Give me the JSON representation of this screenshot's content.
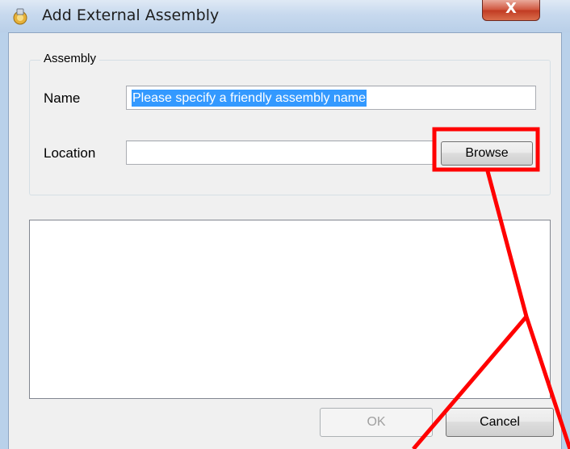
{
  "window": {
    "title": "Add External Assembly",
    "close_glyph": "X"
  },
  "assembly_group": {
    "legend": "Assembly",
    "name_label": "Name",
    "name_value": "Please specify a friendly assembly name",
    "location_label": "Location",
    "location_value": "",
    "browse_label": "Browse"
  },
  "footer": {
    "ok_label": "OK",
    "cancel_label": "Cancel",
    "ok_enabled": false
  },
  "icons": {
    "title_icon": "assembly-icon",
    "close_icon": "close-icon"
  },
  "colors": {
    "annotation": "#ff0000",
    "selection": "#3399ff",
    "close_button": "#c13b23"
  }
}
